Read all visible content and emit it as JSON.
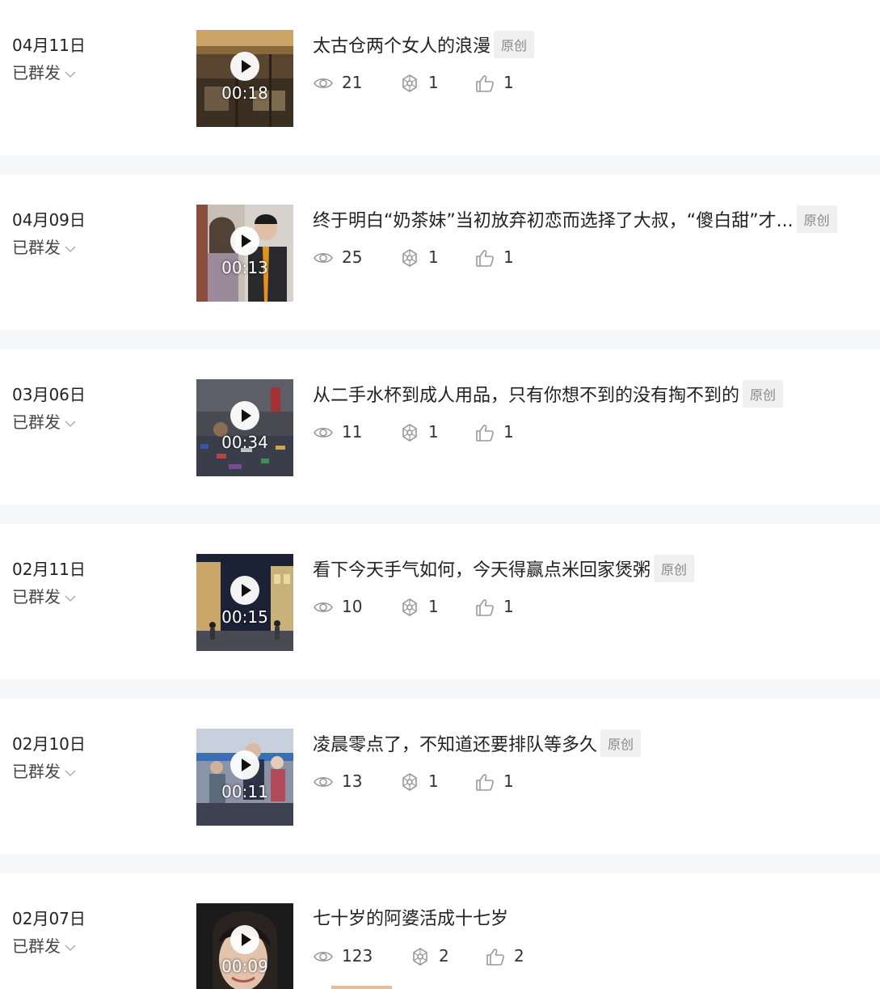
{
  "original_badge": "原创",
  "status_label": "已群发",
  "icons": {
    "views": "eye-icon",
    "shares": "share-icon",
    "likes": "thumbs-up-icon",
    "play": "play-icon",
    "expand": "chevron-down-icon"
  },
  "colors": {
    "badge_bg": "#f0f0f0",
    "badge_text": "#888888",
    "separator": "#f5f6f7"
  },
  "articles": [
    {
      "date": "04月11日",
      "status": "已群发",
      "duration": "00:18",
      "title": "太古仓两个女人的浪漫",
      "original": "原创",
      "views": "21",
      "shares": "1",
      "likes": "1"
    },
    {
      "date": "04月09日",
      "status": "已群发",
      "duration": "00:13",
      "title": "终于明白“奶茶妹”当初放弃初恋而选择了大叔，“傻白甜”才...",
      "original": "原创",
      "views": "25",
      "shares": "1",
      "likes": "1"
    },
    {
      "date": "03月06日",
      "status": "已群发",
      "duration": "00:34",
      "title": "从二手水杯到成人用品，只有你想不到的没有掏不到的",
      "original": "原创",
      "views": "11",
      "shares": "1",
      "likes": "1"
    },
    {
      "date": "02月11日",
      "status": "已群发",
      "duration": "00:15",
      "title": "看下今天手气如何，今天得赢点米回家煲粥",
      "original": "原创",
      "views": "10",
      "shares": "1",
      "likes": "1"
    },
    {
      "date": "02月10日",
      "status": "已群发",
      "duration": "00:11",
      "title": "凌晨零点了，不知道还要排队等多久",
      "original": "原创",
      "views": "13",
      "shares": "1",
      "likes": "1"
    },
    {
      "date": "02月07日",
      "status": "已群发",
      "duration": "00:09",
      "title": "七十岁的阿婆活成十七岁",
      "original": "",
      "views": "123",
      "shares": "2",
      "likes": "2"
    }
  ]
}
